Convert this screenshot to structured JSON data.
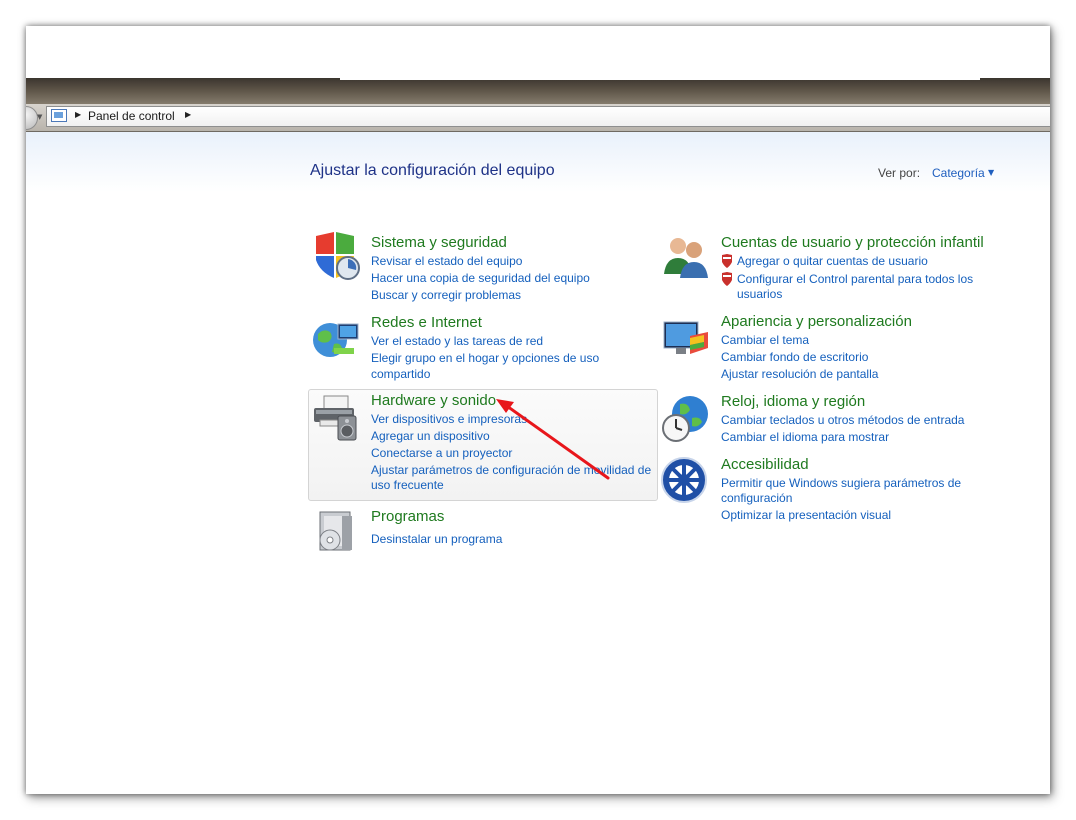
{
  "breadcrumb": {
    "label": "Panel de control"
  },
  "page": {
    "title": "Ajustar la configuración del equipo"
  },
  "viewby": {
    "label": "Ver por:",
    "value": "Categoría"
  },
  "categories": {
    "sistema": {
      "title": "Sistema y seguridad",
      "links": [
        "Revisar el estado del equipo",
        "Hacer una copia de seguridad del equipo",
        "Buscar y corregir problemas"
      ]
    },
    "redes": {
      "title": "Redes e Internet",
      "links": [
        "Ver el estado y las tareas de red",
        "Elegir grupo en el hogar y opciones de uso",
        "compartido"
      ]
    },
    "hardware": {
      "title": "Hardware y sonido",
      "links": [
        "Ver dispositivos e impresoras",
        "Agregar un dispositivo",
        "Conectarse a un proyector",
        "Ajustar parámetros de configuración de movilidad de",
        "uso frecuente"
      ]
    },
    "programas": {
      "title": "Programas",
      "links": [
        "Desinstalar un programa"
      ]
    },
    "cuentas": {
      "title": "Cuentas de usuario y protección infantil",
      "links": [
        "Agregar o quitar cuentas de usuario",
        "Configurar el Control parental para todos los",
        "usuarios"
      ]
    },
    "apariencia": {
      "title": "Apariencia y personalización",
      "links": [
        "Cambiar el tema",
        "Cambiar fondo de escritorio",
        "Ajustar resolución de pantalla"
      ]
    },
    "reloj": {
      "title": "Reloj, idioma y región",
      "links": [
        "Cambiar teclados u otros métodos de entrada",
        "Cambiar el idioma para mostrar"
      ]
    },
    "accesibilidad": {
      "title": "Accesibilidad",
      "links": [
        "Permitir que Windows sugiera parámetros de",
        "configuración",
        "Optimizar la presentación visual"
      ]
    }
  },
  "colors": {
    "title": "#1e3287",
    "category": "#1f7a1f",
    "link": "#1560bd",
    "annotation_arrow": "#e8161b"
  }
}
